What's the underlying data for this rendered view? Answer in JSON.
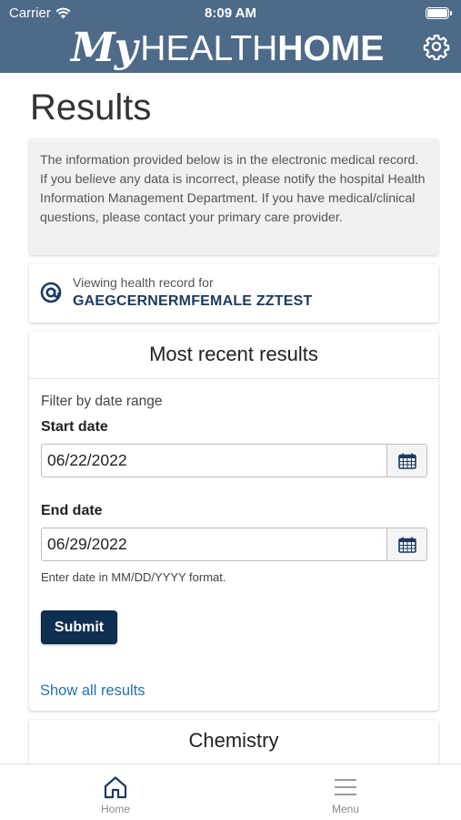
{
  "status_bar": {
    "carrier": "Carrier",
    "time": "8:09 AM"
  },
  "header": {
    "brand_my": "My",
    "brand_health": "HEALTH",
    "brand_home": "HOME",
    "settings_icon": "gear-icon",
    "background_color": "#4d6a88"
  },
  "page": {
    "title": "Results"
  },
  "notice": {
    "text": "The information provided below is in the electronic medical record.  If you believe any data is incorrect, please notify the hospital Health Information Management Department. If you have medical/clinical questions, please contact your primary care provider."
  },
  "patient": {
    "viewing_label": "Viewing health record for",
    "name": "GAEGCERNERMFEMALE ZZTEST",
    "icon": "at-sign-icon"
  },
  "results": {
    "title": "Most recent results",
    "filter_label": "Filter by date range",
    "start_label": "Start date",
    "start_value": "06/22/2022",
    "end_label": "End date",
    "end_value": "06/29/2022",
    "hint": "Enter date in MM/DD/YYYY format.",
    "submit_label": "Submit",
    "show_all_label": "Show all results",
    "calendar_icon": "calendar-icon"
  },
  "chemistry": {
    "title": "Chemistry"
  },
  "tab_bar": {
    "home_label": "Home",
    "menu_label": "Menu",
    "accent_color": "#1c3a5e"
  }
}
